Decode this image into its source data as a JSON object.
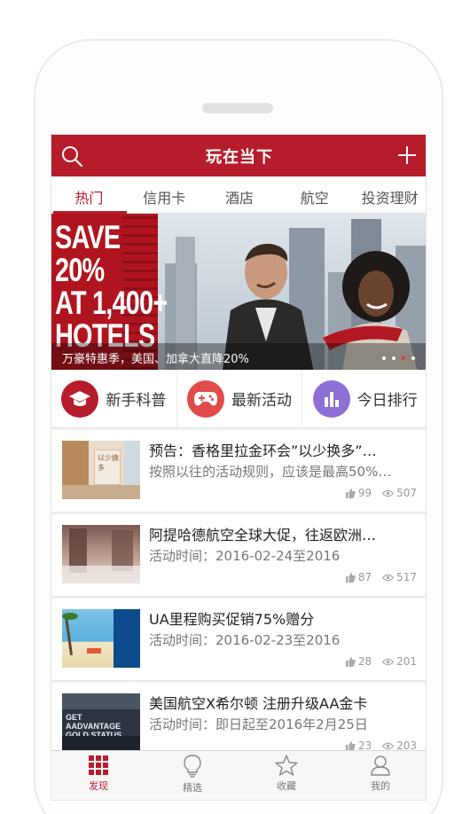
{
  "header": {
    "title": "玩在当下"
  },
  "tabs": [
    {
      "label": "热门"
    },
    {
      "label": "信用卡"
    },
    {
      "label": "酒店"
    },
    {
      "label": "航空"
    },
    {
      "label": "投资理财"
    }
  ],
  "banner": {
    "promo_text": "SAVE\n20%\nAT 1,400+\nHOTELS",
    "caption": "万豪特惠季，美国、加拿大直降20%",
    "slides": 4,
    "active_slide": 3
  },
  "quick_actions": [
    {
      "label": "新手科普",
      "icon": "graduation-cap-icon",
      "color": "#b71c2b"
    },
    {
      "label": "最新活动",
      "icon": "gamepad-icon",
      "color": "#e24b4b"
    },
    {
      "label": "今日排行",
      "icon": "bar-chart-icon",
      "color": "#8e6fd6"
    }
  ],
  "articles": [
    {
      "title": "预告：香格里拉金环会”以少换多”…",
      "subtitle": "按照以往的活动规则，应该是最高50%…",
      "likes": "99",
      "views": "507"
    },
    {
      "title": "阿提哈德航空全球大促，往返欧洲…",
      "subtitle": "活动时间：2016-02-24至2016",
      "likes": "87",
      "views": "517"
    },
    {
      "title": "UA里程购买促销75%赠分",
      "subtitle": "活动时间：2016-02-23至2016",
      "likes": "28",
      "views": "201"
    },
    {
      "title": "美国航空X希尔顿 注册升级AA金卡",
      "subtitle": "活动时间：即日起至2016年2月25日",
      "likes": "23",
      "views": "203"
    }
  ],
  "thumbs": {
    "t1": "以少换多",
    "t4": "GET AADVANTAGE GOLD STATUS"
  },
  "bottom_nav": [
    {
      "label": "发现",
      "icon": "grid-icon"
    },
    {
      "label": "精选",
      "icon": "lightbulb-icon"
    },
    {
      "label": "收藏",
      "icon": "star-icon"
    },
    {
      "label": "我的",
      "icon": "user-icon"
    }
  ],
  "colors": {
    "brand": "#b71c2b"
  }
}
